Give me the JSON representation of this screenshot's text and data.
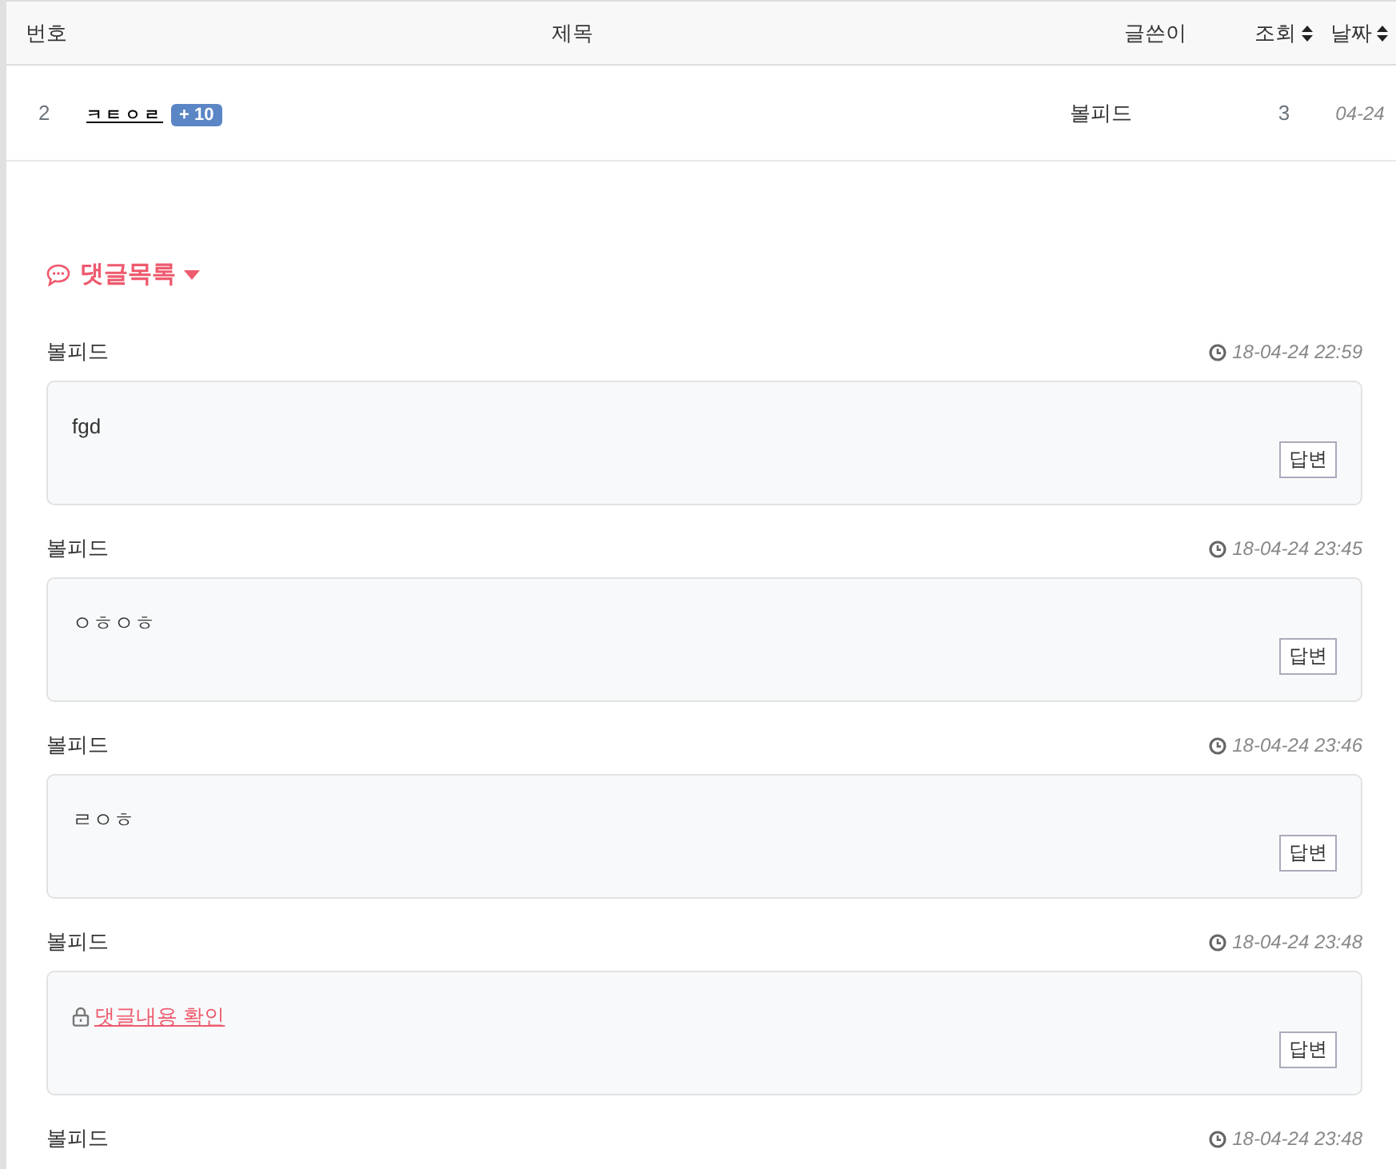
{
  "table": {
    "columns": [
      {
        "label": "번호",
        "sortable": false
      },
      {
        "label": "제목",
        "sortable": false
      },
      {
        "label": "글쓴이",
        "sortable": false
      },
      {
        "label": "조회",
        "sortable": true
      },
      {
        "label": "날짜",
        "sortable": true
      }
    ],
    "rows": [
      {
        "number": "2",
        "title": "ㅋㅌㅇㄹ",
        "badge": "+ 10",
        "author": "볼피드",
        "views": "3",
        "date": "04-24"
      }
    ]
  },
  "comments_heading": "댓글목록",
  "comments": [
    {
      "kind": "text",
      "author": "볼피드",
      "time": "18-04-24 22:59",
      "body": "fgd",
      "reply": "답변"
    },
    {
      "kind": "text",
      "author": "볼피드",
      "time": "18-04-24 23:45",
      "body": "ㅇㅎㅇㅎ",
      "reply": "답변"
    },
    {
      "kind": "text",
      "author": "볼피드",
      "time": "18-04-24 23:46",
      "body": "ㄹㅇㅎ",
      "reply": "답변"
    },
    {
      "kind": "locked",
      "author": "볼피드",
      "time": "18-04-24 23:48",
      "body": "댓글내용 확인",
      "reply": "답변"
    },
    {
      "kind": "cut",
      "author": "볼피드",
      "time": "18-04-24 23:48"
    }
  ]
}
